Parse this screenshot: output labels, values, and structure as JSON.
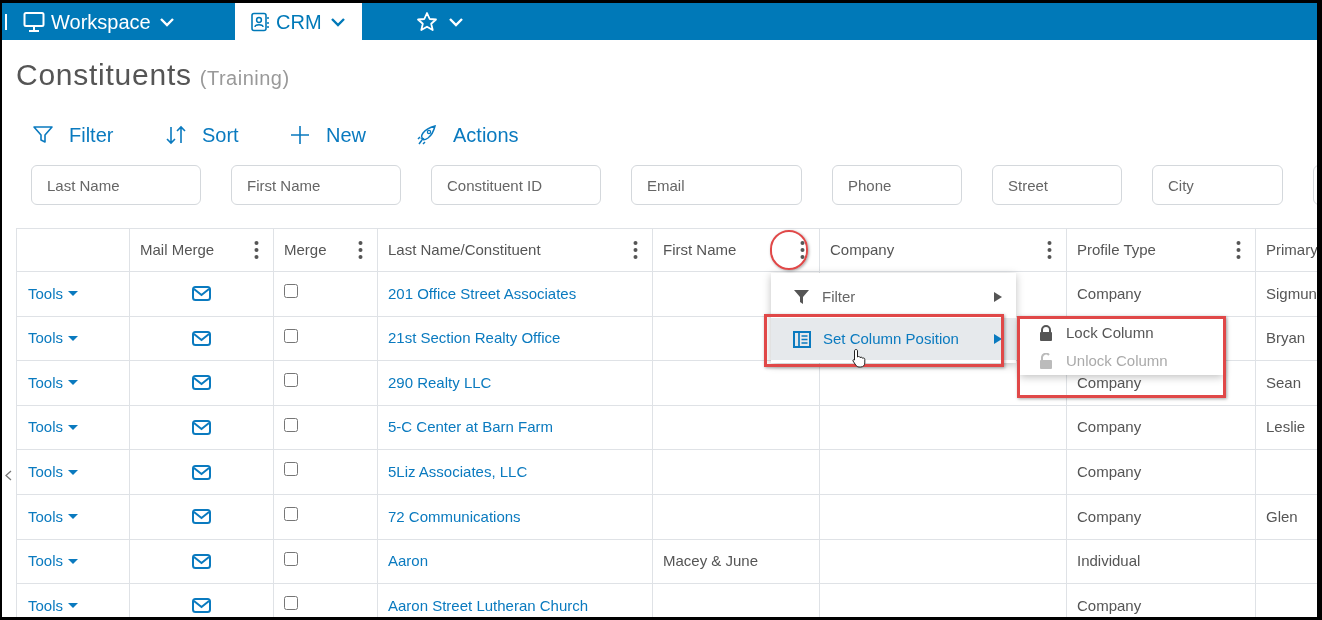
{
  "nav": {
    "tabs": [
      {
        "kind": "workspace",
        "label": "Workspace",
        "selected": false
      },
      {
        "kind": "crm",
        "label": "CRM",
        "selected": true
      },
      {
        "kind": "favorites",
        "selected": false
      }
    ]
  },
  "page": {
    "title": "Constituents",
    "subtitle": "(Training)"
  },
  "toolbar": [
    {
      "kind": "filter",
      "label": "Filter"
    },
    {
      "kind": "sort",
      "label": "Sort"
    },
    {
      "kind": "new",
      "label": "New"
    },
    {
      "kind": "actions",
      "label": "Actions"
    }
  ],
  "filters": [
    {
      "placeholder": "Last Name"
    },
    {
      "placeholder": "First Name"
    },
    {
      "placeholder": "Constituent ID"
    },
    {
      "placeholder": "Email"
    },
    {
      "placeholder": "Phone"
    },
    {
      "placeholder": "Street"
    },
    {
      "placeholder": "City"
    }
  ],
  "table": {
    "columns": [
      {
        "menu": false
      },
      {
        "label": "Mail Merge",
        "menu": true
      },
      {
        "label": "Merge",
        "menu": true
      },
      {
        "label": "Last Name/Constituent",
        "menu": true
      },
      {
        "label": "First Name",
        "menu": true
      },
      {
        "label": "Company",
        "menu": true
      },
      {
        "label": "Profile Type",
        "menu": true
      },
      {
        "label": "Primary",
        "menu": false
      }
    ],
    "rows": [
      {
        "tools": "Tools",
        "merge": false,
        "name": "201 Office Street Associates",
        "profile_type": "Company",
        "primary": "Sigmun"
      },
      {
        "tools": "Tools",
        "merge": false,
        "name": "21st Section Realty Office",
        "primary": "Bryan"
      },
      {
        "tools": "Tools",
        "merge": false,
        "name": "290 Realty LLC",
        "profile_type": "Company",
        "primary": "Sean"
      },
      {
        "tools": "Tools",
        "merge": false,
        "name": "5-C Center at Barn Farm",
        "profile_type": "Company",
        "primary": "Leslie"
      },
      {
        "tools": "Tools",
        "merge": false,
        "name": "5Liz Associates, LLC",
        "profile_type": "Company"
      },
      {
        "tools": "Tools",
        "merge": false,
        "name": "72 Communications",
        "profile_type": "Company",
        "primary": "Glen"
      },
      {
        "tools": "Tools",
        "merge": false,
        "name": "Aaron",
        "first_name": "Macey & June",
        "profile_type": "Individual"
      },
      {
        "tools": "Tools",
        "merge": false,
        "name": "Aaron Street Lutheran Church",
        "profile_type": "Company"
      }
    ]
  },
  "context_menu": {
    "items": [
      {
        "kind": "filter",
        "label": "Filter",
        "selected": false
      },
      {
        "kind": "columns",
        "label": "Set Column Position",
        "selected": true
      }
    ],
    "submenu": [
      {
        "kind": "lock",
        "label": "Lock Column",
        "disabled": false
      },
      {
        "kind": "unlock",
        "label": "Unlock Column",
        "disabled": true
      }
    ]
  }
}
